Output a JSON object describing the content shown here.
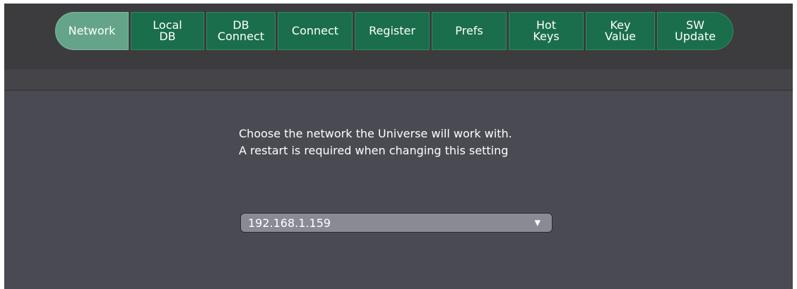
{
  "tabs": [
    {
      "label": "Network",
      "active": true
    },
    {
      "label": "Local\nDB",
      "active": false
    },
    {
      "label": "DB\nConnect",
      "active": false
    },
    {
      "label": "Connect",
      "active": false
    },
    {
      "label": "Register",
      "active": false
    },
    {
      "label": "Prefs",
      "active": false
    },
    {
      "label": "Hot\nKeys",
      "active": false
    },
    {
      "label": "Key\nValue",
      "active": false
    },
    {
      "label": "SW\nUpdate",
      "active": false
    }
  ],
  "message": {
    "line1": "Choose the network the Universe will work with.",
    "line2": "A restart is required when changing this setting"
  },
  "network_select": {
    "value": "192.168.1.159",
    "arrow_icon": "dropdown-arrow-icon"
  },
  "colors": {
    "tab_green": "#1b6e4b",
    "tab_active": "#64a58a",
    "background": "#4a4a52"
  }
}
